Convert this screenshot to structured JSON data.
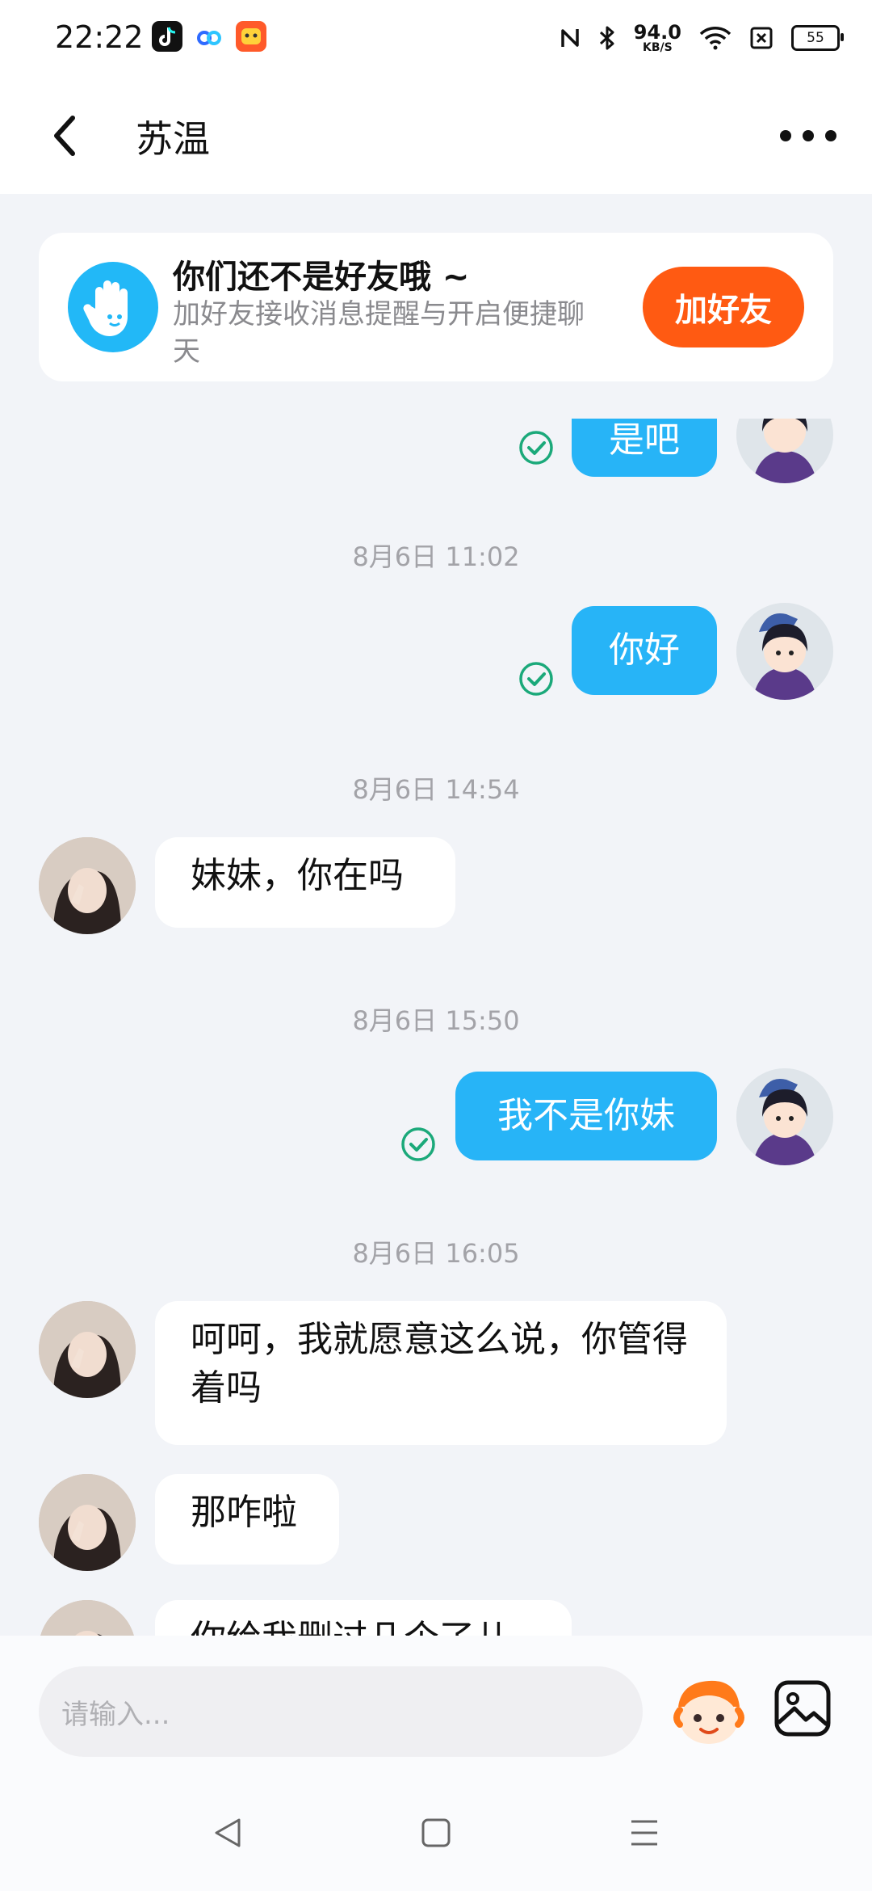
{
  "status_bar": {
    "time": "22:22",
    "app_icons": [
      "tiktok-icon",
      "baidu-netdisk-icon",
      "app-icon"
    ],
    "net_speed_value": "94.0",
    "net_speed_unit": "KB/S",
    "battery": "55"
  },
  "header": {
    "title": "苏温"
  },
  "friend_banner": {
    "title": "你们还不是好友哦 ~",
    "subtitle": "加好友接收消息提醒与开启便捷聊天",
    "button": "加好友"
  },
  "messages": {
    "partial_top": "是吧",
    "t1": "8月6日 11:02",
    "m1": "你好",
    "t2": "8月6日 14:54",
    "m2": "妹妹，你在吗",
    "t3": "8月6日 15:50",
    "m3": "我不是你妹",
    "t4": "8月6日 16:05",
    "m4": "呵呵，我就愿意这么说，你管得着吗",
    "m5": "那咋啦",
    "m6_partial": "你给我删过几个了儿"
  },
  "input": {
    "placeholder": "请输入..."
  },
  "colors": {
    "outgoing_bubble": "#27b4f7",
    "add_friend_button": "#ff5a12",
    "read_check": "#1ba97a"
  }
}
